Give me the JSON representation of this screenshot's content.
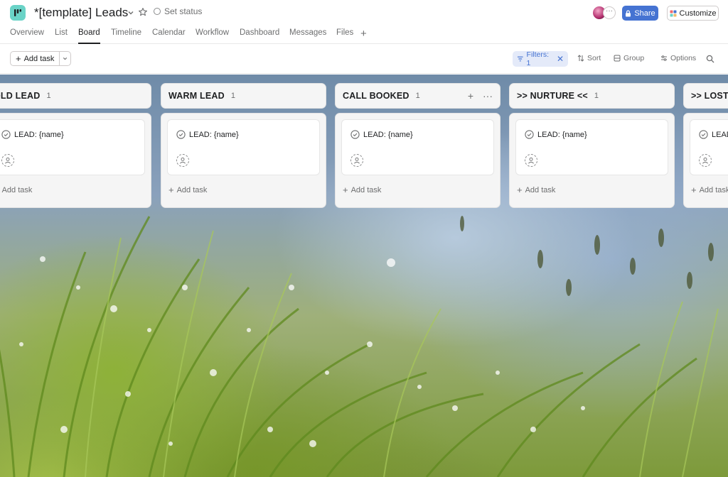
{
  "header": {
    "project_title": "*[template] Leads",
    "set_status_label": "Set status",
    "share_label": "Share",
    "customize_label": "Customize",
    "more_avatars_label": "···"
  },
  "tabs": [
    {
      "label": "Overview"
    },
    {
      "label": "List"
    },
    {
      "label": "Board",
      "active": true
    },
    {
      "label": "Timeline"
    },
    {
      "label": "Calendar"
    },
    {
      "label": "Workflow"
    },
    {
      "label": "Dashboard"
    },
    {
      "label": "Messages"
    },
    {
      "label": "Files"
    }
  ],
  "toolbar": {
    "add_task_label": "Add task",
    "filters_label": "Filters: 1",
    "sort_label": "Sort",
    "group_label": "Group",
    "options_label": "Options"
  },
  "columns": [
    {
      "title": "OLD LEAD",
      "count": "1",
      "task": "LEAD: {name}",
      "add_task": "Add task"
    },
    {
      "title": "WARM LEAD",
      "count": "1",
      "task": "LEAD: {name}",
      "add_task": "Add task"
    },
    {
      "title": "CALL BOOKED",
      "count": "1",
      "task": "LEAD: {name}",
      "add_task": "Add task"
    },
    {
      "title": ">> NURTURE <<",
      "count": "1",
      "task": "LEAD: {name}",
      "add_task": "Add task"
    },
    {
      "title": ">> LOST",
      "count": "",
      "task": "LEAD: {name}",
      "add_task": "Add task"
    }
  ],
  "colors": {
    "accent": "#4573d2",
    "filter_bg": "#e4eaf9",
    "app_icon": "#6ad3c7"
  },
  "icons": {
    "app": "board-app-icon",
    "star": "star-icon",
    "search": "search-icon",
    "check": "check-circle-icon",
    "assignee": "user-icon"
  }
}
